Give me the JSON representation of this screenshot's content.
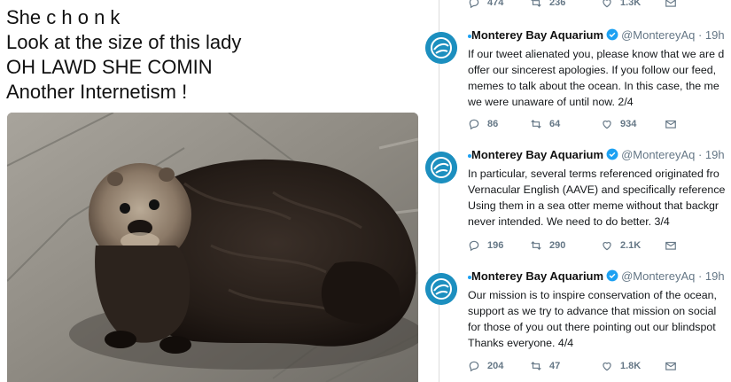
{
  "meme": {
    "lines": [
      "She c h o n k",
      "Look at the size of this lady",
      "OH LAWD SHE COMIN",
      "Another Internetism !"
    ]
  },
  "top_actions": {
    "reply": "474",
    "retweet": "236",
    "like": "1.3K"
  },
  "tweets": [
    {
      "name": "Monterey Bay Aquarium",
      "handle": "@MontereyAq",
      "time": "19h",
      "lines": [
        "If our tweet alienated you, please know that we are d",
        "offer our sincerest apologies. If you follow our feed,",
        "memes to talk about the ocean. In this case, the me",
        "we were unaware of until now. 2/4"
      ],
      "reply": "86",
      "retweet": "64",
      "like": "934"
    },
    {
      "name": "Monterey Bay Aquarium",
      "handle": "@MontereyAq",
      "time": "19h",
      "lines": [
        "In particular, several terms referenced originated fro",
        "Vernacular English (AAVE) and specifically reference",
        "Using them in a sea otter meme without that backgr",
        "never intended. We need to do better. 3/4"
      ],
      "reply": "196",
      "retweet": "290",
      "like": "2.1K"
    },
    {
      "name": "Monterey Bay Aquarium",
      "handle": "@MontereyAq",
      "time": "19h",
      "lines": [
        "Our mission is to inspire conservation of the ocean,",
        "support as we try to advance that mission on social",
        "for those of you out there pointing out our blindspot",
        "Thanks everyone. 4/4"
      ],
      "reply": "204",
      "retweet": "47",
      "like": "1.8K"
    }
  ],
  "icons": {
    "reply": "reply-icon",
    "retweet": "retweet-icon",
    "like": "heart-icon",
    "dm": "direct-message-icon",
    "verified": "verified-badge-icon"
  },
  "colors": {
    "twitter_blue": "#1da1f2",
    "avatar_blue": "#1c8fbf",
    "meta_gray": "#657786"
  }
}
